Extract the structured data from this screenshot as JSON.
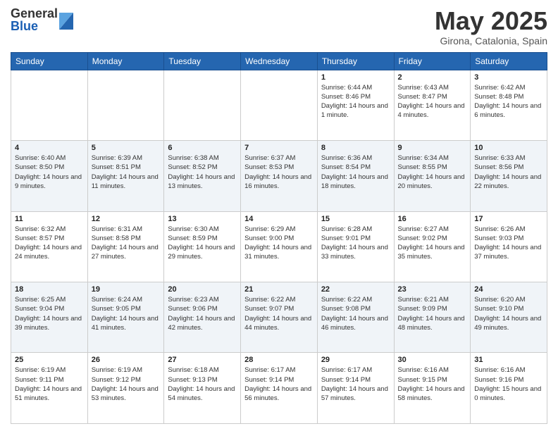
{
  "logo": {
    "general": "General",
    "blue": "Blue"
  },
  "title": "May 2025",
  "location": "Girona, Catalonia, Spain",
  "days_of_week": [
    "Sunday",
    "Monday",
    "Tuesday",
    "Wednesday",
    "Thursday",
    "Friday",
    "Saturday"
  ],
  "weeks": [
    [
      {
        "day": "",
        "info": ""
      },
      {
        "day": "",
        "info": ""
      },
      {
        "day": "",
        "info": ""
      },
      {
        "day": "",
        "info": ""
      },
      {
        "day": "1",
        "info": "Sunrise: 6:44 AM\nSunset: 8:46 PM\nDaylight: 14 hours and 1 minute."
      },
      {
        "day": "2",
        "info": "Sunrise: 6:43 AM\nSunset: 8:47 PM\nDaylight: 14 hours and 4 minutes."
      },
      {
        "day": "3",
        "info": "Sunrise: 6:42 AM\nSunset: 8:48 PM\nDaylight: 14 hours and 6 minutes."
      }
    ],
    [
      {
        "day": "4",
        "info": "Sunrise: 6:40 AM\nSunset: 8:50 PM\nDaylight: 14 hours and 9 minutes."
      },
      {
        "day": "5",
        "info": "Sunrise: 6:39 AM\nSunset: 8:51 PM\nDaylight: 14 hours and 11 minutes."
      },
      {
        "day": "6",
        "info": "Sunrise: 6:38 AM\nSunset: 8:52 PM\nDaylight: 14 hours and 13 minutes."
      },
      {
        "day": "7",
        "info": "Sunrise: 6:37 AM\nSunset: 8:53 PM\nDaylight: 14 hours and 16 minutes."
      },
      {
        "day": "8",
        "info": "Sunrise: 6:36 AM\nSunset: 8:54 PM\nDaylight: 14 hours and 18 minutes."
      },
      {
        "day": "9",
        "info": "Sunrise: 6:34 AM\nSunset: 8:55 PM\nDaylight: 14 hours and 20 minutes."
      },
      {
        "day": "10",
        "info": "Sunrise: 6:33 AM\nSunset: 8:56 PM\nDaylight: 14 hours and 22 minutes."
      }
    ],
    [
      {
        "day": "11",
        "info": "Sunrise: 6:32 AM\nSunset: 8:57 PM\nDaylight: 14 hours and 24 minutes."
      },
      {
        "day": "12",
        "info": "Sunrise: 6:31 AM\nSunset: 8:58 PM\nDaylight: 14 hours and 27 minutes."
      },
      {
        "day": "13",
        "info": "Sunrise: 6:30 AM\nSunset: 8:59 PM\nDaylight: 14 hours and 29 minutes."
      },
      {
        "day": "14",
        "info": "Sunrise: 6:29 AM\nSunset: 9:00 PM\nDaylight: 14 hours and 31 minutes."
      },
      {
        "day": "15",
        "info": "Sunrise: 6:28 AM\nSunset: 9:01 PM\nDaylight: 14 hours and 33 minutes."
      },
      {
        "day": "16",
        "info": "Sunrise: 6:27 AM\nSunset: 9:02 PM\nDaylight: 14 hours and 35 minutes."
      },
      {
        "day": "17",
        "info": "Sunrise: 6:26 AM\nSunset: 9:03 PM\nDaylight: 14 hours and 37 minutes."
      }
    ],
    [
      {
        "day": "18",
        "info": "Sunrise: 6:25 AM\nSunset: 9:04 PM\nDaylight: 14 hours and 39 minutes."
      },
      {
        "day": "19",
        "info": "Sunrise: 6:24 AM\nSunset: 9:05 PM\nDaylight: 14 hours and 41 minutes."
      },
      {
        "day": "20",
        "info": "Sunrise: 6:23 AM\nSunset: 9:06 PM\nDaylight: 14 hours and 42 minutes."
      },
      {
        "day": "21",
        "info": "Sunrise: 6:22 AM\nSunset: 9:07 PM\nDaylight: 14 hours and 44 minutes."
      },
      {
        "day": "22",
        "info": "Sunrise: 6:22 AM\nSunset: 9:08 PM\nDaylight: 14 hours and 46 minutes."
      },
      {
        "day": "23",
        "info": "Sunrise: 6:21 AM\nSunset: 9:09 PM\nDaylight: 14 hours and 48 minutes."
      },
      {
        "day": "24",
        "info": "Sunrise: 6:20 AM\nSunset: 9:10 PM\nDaylight: 14 hours and 49 minutes."
      }
    ],
    [
      {
        "day": "25",
        "info": "Sunrise: 6:19 AM\nSunset: 9:11 PM\nDaylight: 14 hours and 51 minutes."
      },
      {
        "day": "26",
        "info": "Sunrise: 6:19 AM\nSunset: 9:12 PM\nDaylight: 14 hours and 53 minutes."
      },
      {
        "day": "27",
        "info": "Sunrise: 6:18 AM\nSunset: 9:13 PM\nDaylight: 14 hours and 54 minutes."
      },
      {
        "day": "28",
        "info": "Sunrise: 6:17 AM\nSunset: 9:14 PM\nDaylight: 14 hours and 56 minutes."
      },
      {
        "day": "29",
        "info": "Sunrise: 6:17 AM\nSunset: 9:14 PM\nDaylight: 14 hours and 57 minutes."
      },
      {
        "day": "30",
        "info": "Sunrise: 6:16 AM\nSunset: 9:15 PM\nDaylight: 14 hours and 58 minutes."
      },
      {
        "day": "31",
        "info": "Sunrise: 6:16 AM\nSunset: 9:16 PM\nDaylight: 15 hours and 0 minutes."
      }
    ]
  ]
}
